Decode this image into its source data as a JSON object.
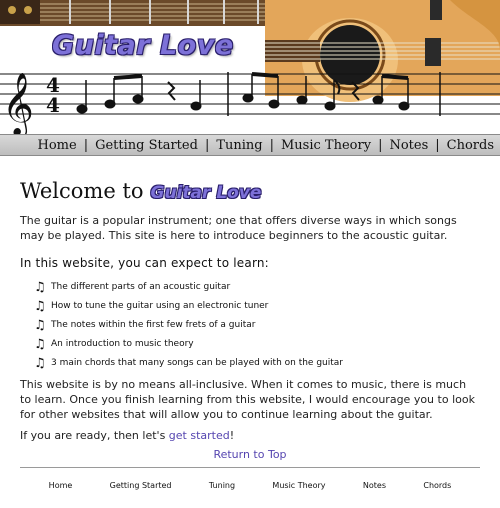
{
  "site": {
    "logo_text": "Guitar Love"
  },
  "nav": {
    "items": [
      {
        "label": "Home"
      },
      {
        "label": "Getting Started"
      },
      {
        "label": "Tuning"
      },
      {
        "label": "Music Theory"
      },
      {
        "label": "Notes"
      },
      {
        "label": "Chords"
      }
    ],
    "separator": "|"
  },
  "main": {
    "heading_prefix": "Welcome to",
    "heading_logo": "Guitar Love",
    "intro": "The guitar is a popular instrument; one that offers diverse ways in which songs may be played. This site is here to introduce beginners to the acoustic guitar.",
    "learn_heading": "In this website, you can expect to learn:",
    "bullet_icon": "music-note-icon",
    "learn_items": [
      "The different parts of an acoustic guitar",
      "How to tune the guitar using an electronic tuner",
      "The notes within the first few frets of a guitar",
      "An introduction to music theory",
      "3 main chords that many songs can be played with on the guitar"
    ],
    "outro": "This website is by no means all-inclusive. When it comes to music, there is much to learn. Once you finish learning from this website, I would encourage you to look for other websites that will allow you to continue learning about the guitar.",
    "ready_prefix": "If you are ready, then let's ",
    "ready_link": "get started",
    "ready_suffix": "!",
    "return_to_top": "Return to Top"
  },
  "footer": {
    "items": [
      {
        "label": "Home"
      },
      {
        "label": "Getting Started"
      },
      {
        "label": "Tuning"
      },
      {
        "label": "Music Theory"
      },
      {
        "label": "Notes"
      },
      {
        "label": "Chords"
      }
    ]
  },
  "colors": {
    "link": "#5545b0",
    "logo": "#7d71d8",
    "nav_bg": "#c8c8c8"
  }
}
